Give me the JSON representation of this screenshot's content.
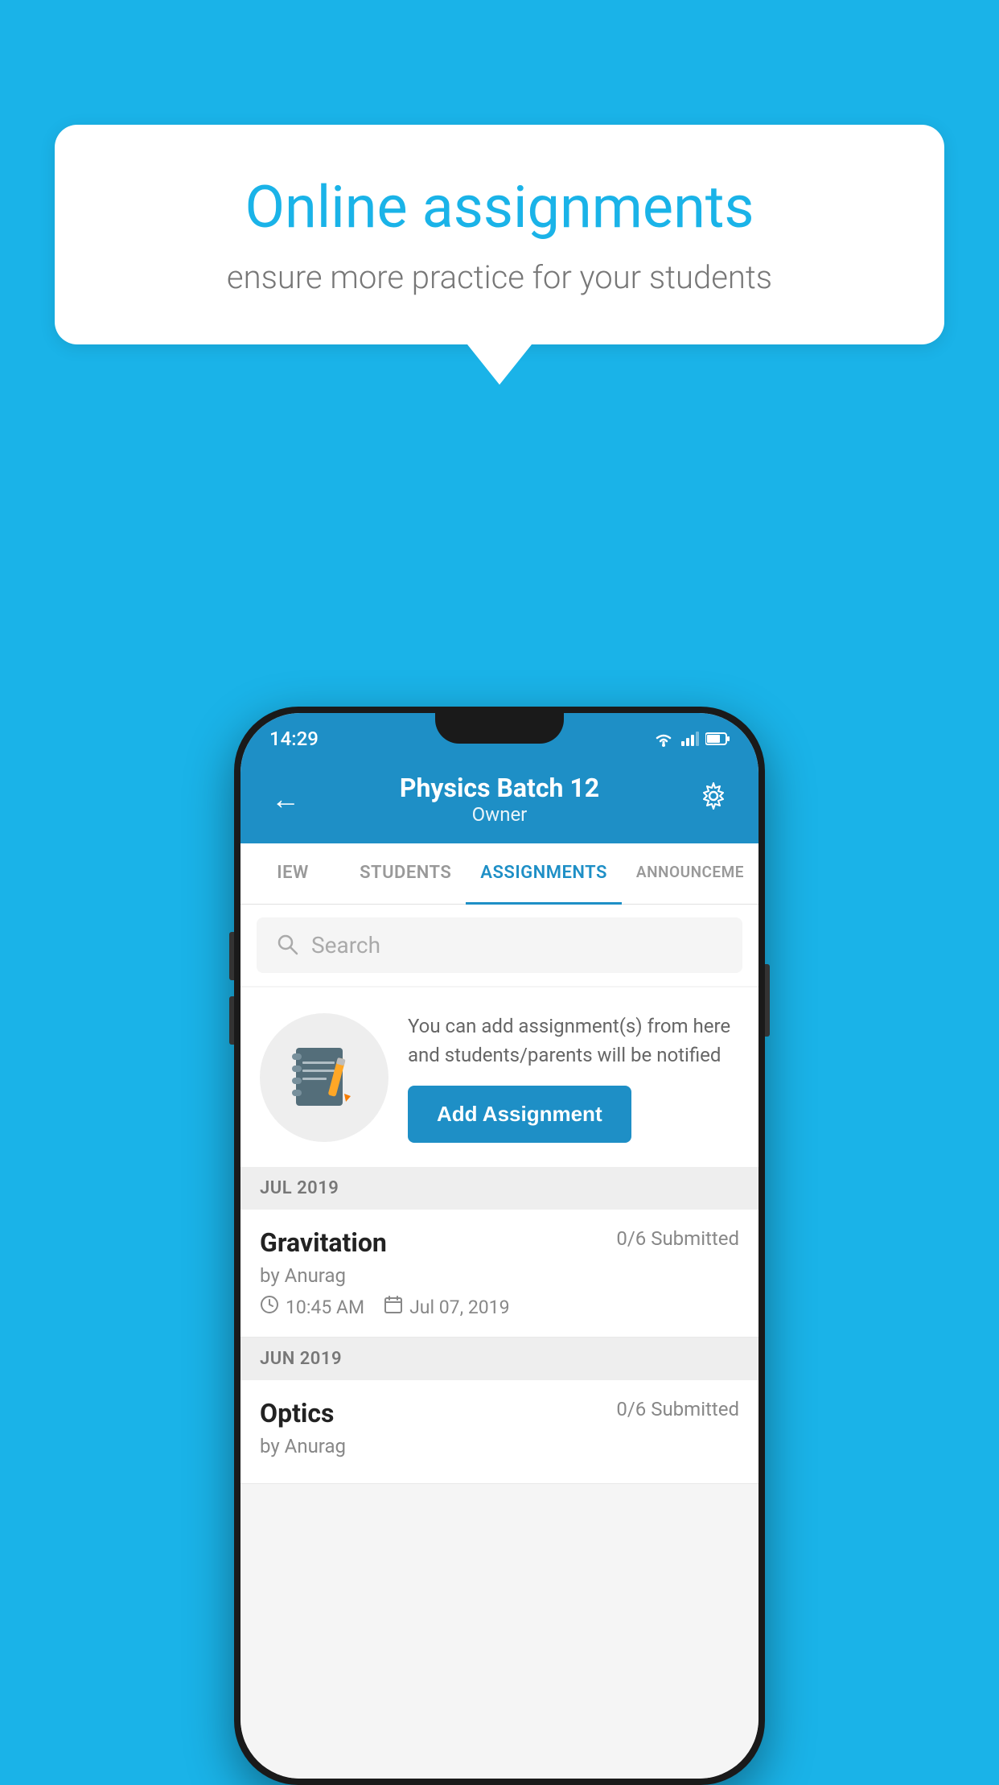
{
  "background_color": "#1ab3e8",
  "speech_bubble": {
    "title": "Online assignments",
    "subtitle": "ensure more practice for your students"
  },
  "status_bar": {
    "time": "14:29"
  },
  "app_header": {
    "title": "Physics Batch 12",
    "subtitle": "Owner",
    "back_label": "←",
    "settings_label": "⚙"
  },
  "tabs": [
    {
      "label": "IEW",
      "active": false
    },
    {
      "label": "STUDENTS",
      "active": false
    },
    {
      "label": "ASSIGNMENTS",
      "active": true
    },
    {
      "label": "ANNOUNCEM...",
      "active": false
    }
  ],
  "search": {
    "placeholder": "Search"
  },
  "promo": {
    "description": "You can add assignment(s) from here and students/parents will be notified",
    "button_label": "Add Assignment"
  },
  "assignment_sections": [
    {
      "month_label": "JUL 2019",
      "assignments": [
        {
          "name": "Gravitation",
          "submitted": "0/6 Submitted",
          "by": "by Anurag",
          "time": "10:45 AM",
          "date": "Jul 07, 2019"
        }
      ]
    },
    {
      "month_label": "JUN 2019",
      "assignments": [
        {
          "name": "Optics",
          "submitted": "0/6 Submitted",
          "by": "by Anurag",
          "time": "",
          "date": ""
        }
      ]
    }
  ]
}
